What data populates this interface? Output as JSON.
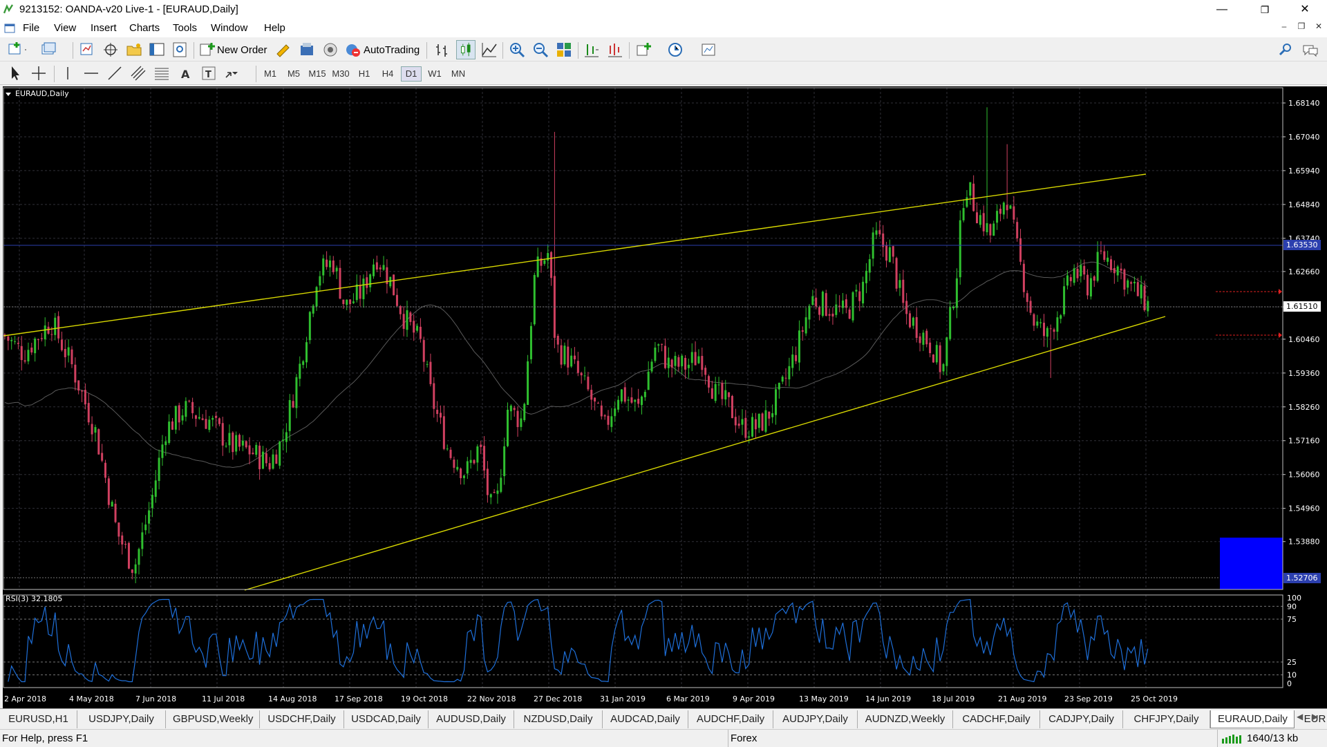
{
  "window": {
    "title": "9213152: OANDA-v20 Live-1 - [EURAUD,Daily]",
    "minimize": "—",
    "restore": "❐",
    "close": "✕"
  },
  "menu": [
    "File",
    "View",
    "Insert",
    "Charts",
    "Tools",
    "Window",
    "Help"
  ],
  "toolbar": {
    "new_order": "New Order",
    "autotrading": "AutoTrading",
    "timeframes": [
      "M1",
      "M5",
      "M15",
      "M30",
      "H1",
      "H4",
      "D1",
      "W1",
      "MN"
    ],
    "active_timeframe": "D1"
  },
  "chart": {
    "symbol_label": "EURAUD,Daily",
    "indicator_label": "RSI(3) 32.1805",
    "price_levels": [
      "1.68140",
      "1.67040",
      "1.65940",
      "1.64840",
      "1.63740",
      "1.62660",
      "1.61510",
      "1.60460",
      "1.59360",
      "1.58260",
      "1.57160",
      "1.56060",
      "1.54960",
      "1.53880",
      "1.52706"
    ],
    "highlight_price": "1.63530",
    "current_price": "1.61510",
    "bottom_price": "1.52706",
    "rsi_levels": [
      "100",
      "90",
      "75",
      "25",
      "10",
      "0"
    ],
    "dates": [
      "2 Apr 2018",
      "4 May 2018",
      "7 Jun 2018",
      "11 Jul 2018",
      "14 Aug 2018",
      "17 Sep 2018",
      "19 Oct 2018",
      "22 Nov 2018",
      "27 Dec 2018",
      "31 Jan 2019",
      "6 Mar 2019",
      "9 Apr 2019",
      "13 May 2019",
      "14 Jun 2019",
      "18 Jul 2019",
      "21 Aug 2019",
      "23 Sep 2019",
      "25 Oct 2019"
    ],
    "colors": {
      "background": "#000000",
      "bull_candle": "#2fbf2f",
      "bear_candle": "#d04060",
      "trendline": "#d8d800",
      "rsi_line": "#1e6fd9",
      "grid": "#303038",
      "highlight_line": "#2b3fae",
      "blue_box": "#0000ff"
    }
  },
  "tabs": [
    "EURUSD,H1",
    "USDJPY,Daily",
    "GBPUSD,Weekly",
    "USDCHF,Daily",
    "USDCAD,Daily",
    "AUDUSD,Daily",
    "NZDUSD,Daily",
    "AUDCAD,Daily",
    "AUDCHF,Daily",
    "AUDJPY,Daily",
    "AUDNZD,Weekly",
    "CADCHF,Daily",
    "CADJPY,Daily",
    "CHFJPY,Daily",
    "EURAUD,Daily",
    "EUR"
  ],
  "active_tab": "EURAUD,Daily",
  "status": {
    "help": "For Help, press F1",
    "profile": "Forex",
    "traffic": "1640/13 kb"
  }
}
